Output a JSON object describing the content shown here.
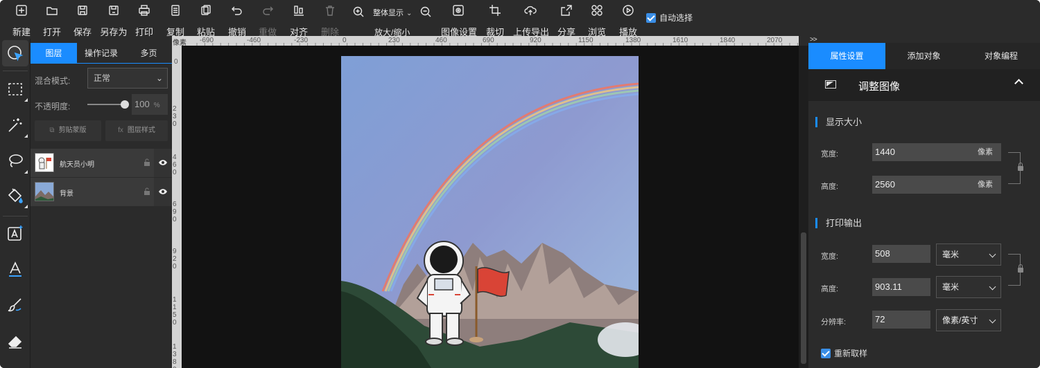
{
  "toolbar": {
    "items": [
      {
        "id": "new",
        "label": "新建",
        "icon": "plus-square-icon"
      },
      {
        "id": "open",
        "label": "打开",
        "icon": "folder-open-icon"
      },
      {
        "id": "save",
        "label": "保存",
        "icon": "save-icon"
      },
      {
        "id": "save_as",
        "label": "另存为",
        "icon": "save-as-icon"
      },
      {
        "id": "print",
        "label": "打印",
        "icon": "printer-icon"
      },
      {
        "id": "copy",
        "label": "复制",
        "icon": "copy-icon"
      },
      {
        "id": "paste",
        "label": "粘贴",
        "icon": "paste-icon"
      },
      {
        "id": "undo",
        "label": "撤销",
        "icon": "undo-icon"
      },
      {
        "id": "redo",
        "label": "重做",
        "icon": "redo-icon",
        "disabled": true
      },
      {
        "id": "align",
        "label": "对齐",
        "icon": "align-icon"
      },
      {
        "id": "delete",
        "label": "删除",
        "icon": "trash-icon",
        "disabled": true
      },
      {
        "id": "image_settings",
        "label": "图像设置",
        "icon": "image-settings-icon"
      },
      {
        "id": "crop",
        "label": "裁切",
        "icon": "crop-icon"
      },
      {
        "id": "upload",
        "label": "上传导出",
        "icon": "cloud-upload-icon"
      },
      {
        "id": "share",
        "label": "分享",
        "icon": "share-icon"
      },
      {
        "id": "browse",
        "label": "浏览",
        "icon": "grid-icon"
      },
      {
        "id": "play",
        "label": "播放",
        "icon": "play-icon"
      }
    ],
    "zoom_mode": "整体显示",
    "zoom_label": "放大/缩小",
    "auto_select": "自动选择"
  },
  "layers_panel": {
    "tabs": [
      "图层",
      "操作记录",
      "多页"
    ],
    "blend_label": "混合模式:",
    "blend_value": "正常",
    "opacity_label": "不透明度:",
    "opacity_value": "100",
    "opacity_unit": "%",
    "opacity_level": 1.0,
    "clip_mask": "剪贴蒙版",
    "layer_style": "图层样式",
    "layers": [
      {
        "name": "航天员小明"
      },
      {
        "name": "背景"
      }
    ]
  },
  "ruler": {
    "unit_label": "像素",
    "h_ticks": [
      "-690",
      "-460",
      "-230",
      "0",
      "230",
      "460",
      "690",
      "920",
      "1150",
      "1380",
      "1610",
      "1840",
      "2070"
    ],
    "v_ticks": [
      "0",
      "230",
      "460",
      "690",
      "920",
      "1150",
      "1380"
    ]
  },
  "props_panel": {
    "expand": ">>",
    "tabs": [
      "属性设置",
      "添加对象",
      "对象编程"
    ],
    "section_header": "调整图像",
    "display_size": {
      "title": "显示大小",
      "width_label": "宽度:",
      "width_value": "1440",
      "height_label": "高度:",
      "height_value": "2560",
      "unit": "像素"
    },
    "print_output": {
      "title": "打印输出",
      "width_label": "宽度:",
      "width_value": "508",
      "width_unit": "毫米",
      "height_label": "高度:",
      "height_value": "903.11",
      "height_unit": "毫米",
      "res_label": "分辨率:",
      "res_value": "72",
      "res_unit": "像素/英寸"
    },
    "resample": "重新取样"
  }
}
